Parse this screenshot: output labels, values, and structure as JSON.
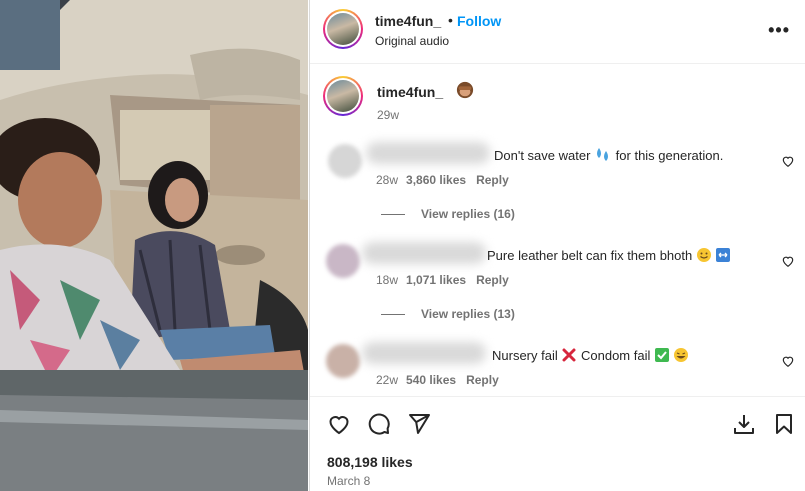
{
  "post": {
    "username": "time4fun_",
    "dot": "•",
    "follow_label": "Follow",
    "audio": "Original audio",
    "more_label": "•••"
  },
  "caption": {
    "username": "time4fun_",
    "emoji": "see-no-evil-monkey",
    "time": "29w"
  },
  "comments": [
    {
      "text": "Don't save water",
      "text_after": "for this generation.",
      "emoji": "droplets",
      "time": "28w",
      "likes": "3,860 likes",
      "reply": "Reply",
      "view_replies": "View replies (16)"
    },
    {
      "text": "Pure leather belt can fix them bhoth",
      "emoji": "smiley-and-arrow",
      "time": "18w",
      "likes": "1,071 likes",
      "reply": "Reply",
      "view_replies": "View replies (13)"
    },
    {
      "text": "Nursery fail",
      "text_mid": "Condom fail",
      "emoji": "cross-check-laugh",
      "time": "22w",
      "likes": "540 likes",
      "reply": "Reply"
    }
  ],
  "footer": {
    "likes": "808,198 likes",
    "date": "March 8"
  },
  "icons": {
    "like": "heart-icon",
    "comment": "comment-icon",
    "share": "send-icon",
    "download": "download-icon",
    "save": "bookmark-icon"
  },
  "colors": {
    "link_blue": "#0095f6",
    "text": "#262626",
    "secondary": "#737373"
  }
}
